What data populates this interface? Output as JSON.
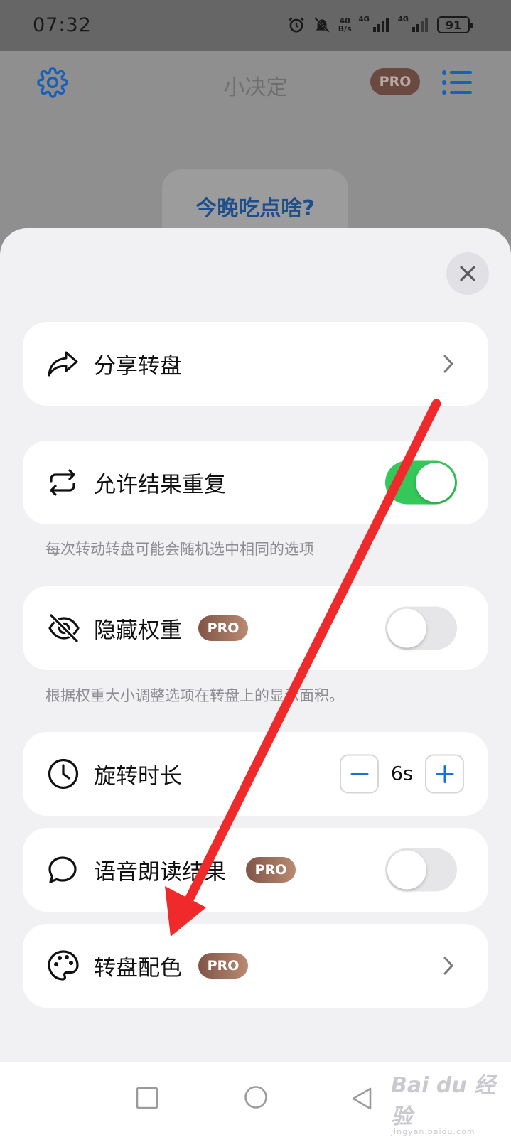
{
  "status_bar": {
    "time": "07:32",
    "net_speed_value": "40",
    "net_speed_unit": "B/s",
    "signal_1_label": "4G",
    "signal_2_label": "4G",
    "battery": "91"
  },
  "app_header": {
    "title": "小决定",
    "pro_badge": "PRO"
  },
  "question": {
    "text": "今晚吃点啥?"
  },
  "sheet": {
    "share": {
      "label": "分享转盘"
    },
    "repeat": {
      "label": "允许结果重复",
      "enabled": true,
      "hint": "每次转动转盘可能会随机选中相同的选项"
    },
    "hide_weight": {
      "label": "隐藏权重",
      "badge": "PRO",
      "enabled": false,
      "hint": "根据权重大小调整选项在转盘上的显示面积。"
    },
    "spin_duration": {
      "label": "旋转时长",
      "value": "6s"
    },
    "voice_read": {
      "label": "语音朗读结果",
      "badge": "PRO",
      "enabled": false
    },
    "wheel_color": {
      "label": "转盘配色",
      "badge": "PRO"
    }
  },
  "watermark": {
    "logo": "Bai du 经验",
    "sub": "jingyan.baidu.com"
  },
  "colors": {
    "accent_blue": "#1b6fd8",
    "toggle_on": "#34c759",
    "annotation_arrow": "#f02a2a"
  }
}
